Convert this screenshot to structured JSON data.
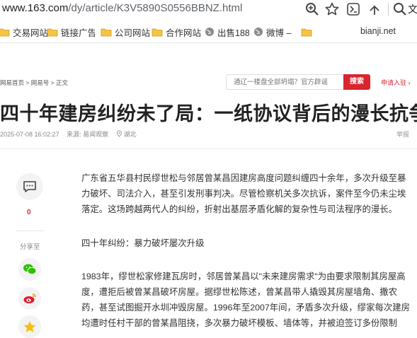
{
  "browser": {
    "url_host": "www.163.com",
    "url_path": "/dy/article/K3V5890S0556BBNZ.html",
    "icons": [
      "zoom-icon",
      "star-icon",
      "extensions-icon",
      "search-icon"
    ],
    "right_label": "文"
  },
  "bookmarks": {
    "items": [
      {
        "label": "交易网站",
        "icon": "folder-icon"
      },
      {
        "label": "链接广告",
        "icon": "folder-icon"
      },
      {
        "label": "公司网站",
        "icon": "folder-icon"
      },
      {
        "label": "合作网站",
        "icon": "folder-icon"
      },
      {
        "label": "出售188",
        "icon": "globe-icon"
      },
      {
        "label": "微博 –",
        "icon": "globe-icon"
      },
      {
        "label": "",
        "icon": "folder-icon"
      }
    ],
    "right": "bianji.net"
  },
  "site": {
    "breadcrumb": [
      "网易首页",
      "网易号",
      "正文"
    ],
    "search_placeholder": "通辽一楼盘全部坍塌？官方辟谣",
    "search_button": "搜索",
    "apply_link": "申请入驻 ›"
  },
  "article": {
    "title": "四十年建房纠纷未了局：一纸协议背后的漫长抗争",
    "datetime": "2025-07-08 16:02:27",
    "source": "来源: 易闻观察",
    "location": "湖北",
    "report": "举报",
    "para1": "广东省五华县村民缪世松与邻居曾某昌因建房高度问题纠缠四十余年，多次升级至暴力破坏、司法介入，甚至引发刑事判决。尽管检察机关多次抗诉，案件至今仍未尘埃落定。这场跨越两代人的纠纷，折射出基层矛盾化解的复杂性与司法程序的漫长。",
    "heading1": "四十年纠纷：暴力破坏屡次升级",
    "para2": "1983年，缪世松家修建瓦房时，邻居曾某昌以\"未来建房需求\"为由要求限制其房屋高度，遭拒后被曾某昌破坏房屋。据缪世松陈述，曾某昌带人撬毁其房屋墙角、撒农药，甚至试图掘开水圳冲毁房屋。1996年至2007年间，矛盾多次升级，缪家每次建房均遭时任村干部的曾某昌阻挠，多次暴力破坏模板、墙体等，并被迫签订多份限制"
  },
  "rail": {
    "comment_count": "0",
    "share_label": "分享至"
  }
}
